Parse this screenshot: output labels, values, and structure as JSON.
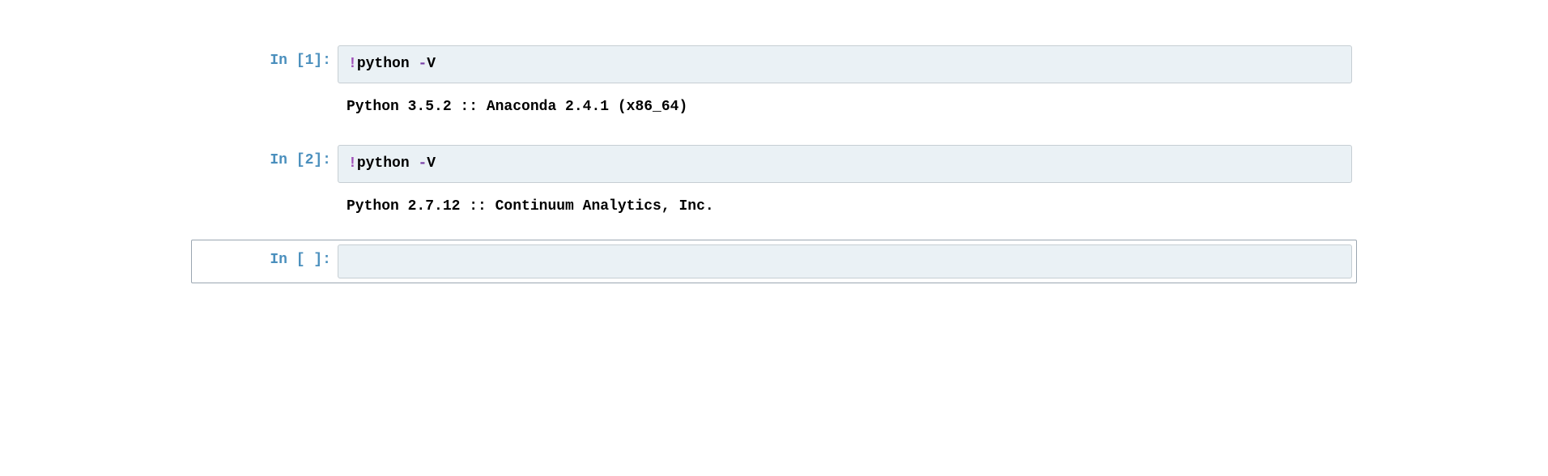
{
  "cells": [
    {
      "prompt": "In [1]:",
      "bang": "!",
      "cmd": "python ",
      "op": "-",
      "arg": "V",
      "output": "Python 3.5.2 :: Anaconda 2.4.1 (x86_64)"
    },
    {
      "prompt": "In [2]:",
      "bang": "!",
      "cmd": "python ",
      "op": "-",
      "arg": "V",
      "output": "Python 2.7.12 :: Continuum Analytics, Inc."
    }
  ],
  "empty_cell": {
    "prompt": "In [ ]:"
  }
}
